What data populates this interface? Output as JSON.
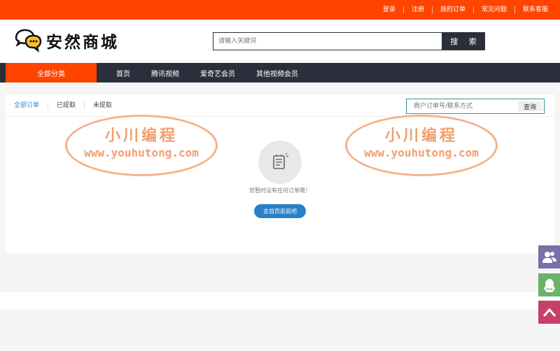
{
  "topbar": {
    "links": [
      "登录",
      "注册",
      "我的订单",
      "常见问题",
      "联系客服"
    ],
    "bg_color": "#ff4400"
  },
  "header": {
    "logo_text": "安然商城",
    "search_placeholder": "请输入关键词",
    "search_button": "搜 索"
  },
  "nav": {
    "all_categories": "全部分类",
    "items": [
      "首页",
      "腾讯视频",
      "爱奇艺会员",
      "其他视频会员"
    ]
  },
  "orders": {
    "tabs": [
      "全部订单",
      "已提取",
      "未提取"
    ],
    "search_placeholder": "商户订单号/联系方式",
    "search_button": "查询",
    "empty_message": "您暂时没有任何订单哦！",
    "go_home_button": "去首页逛逛吧"
  },
  "watermark": {
    "title": "小川编程",
    "url": "www.youhutong.com"
  },
  "side_buttons": {
    "icons": [
      "users-icon",
      "qq-icon",
      "back-to-top-icon"
    ]
  }
}
